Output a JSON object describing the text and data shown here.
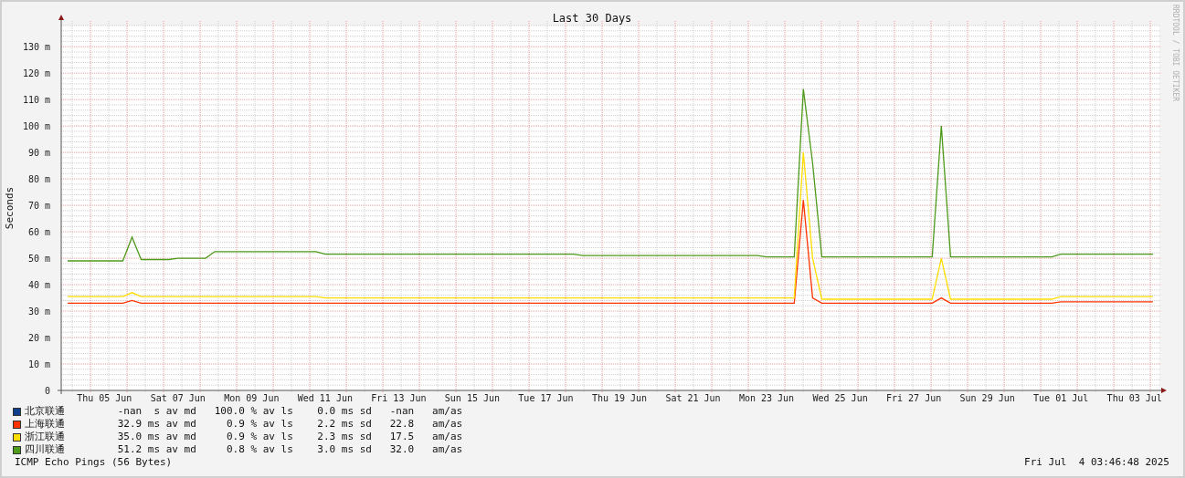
{
  "chart": {
    "chart_data": {
      "type": "line",
      "title": "Last 30 Days",
      "ylabel": "Seconds",
      "categories": [
        null,
        null,
        null,
        null,
        "Thu 05 Jun",
        null,
        null,
        null,
        null,
        null,
        null,
        null,
        "Sat 07 Jun",
        null,
        null,
        null,
        null,
        null,
        null,
        null,
        "Mon 09 Jun",
        null,
        null,
        null,
        null,
        null,
        null,
        null,
        "Wed 11 Jun",
        null,
        null,
        null,
        null,
        null,
        null,
        null,
        "Fri 13 Jun",
        null,
        null,
        null,
        null,
        null,
        null,
        null,
        "Sun 15 Jun",
        null,
        null,
        null,
        null,
        null,
        null,
        null,
        "Tue 17 Jun",
        null,
        null,
        null,
        null,
        null,
        null,
        null,
        "Thu 19 Jun",
        null,
        null,
        null,
        null,
        null,
        null,
        null,
        "Sat 21 Jun",
        null,
        null,
        null,
        null,
        null,
        null,
        null,
        "Mon 23 Jun",
        null,
        null,
        null,
        null,
        null,
        null,
        null,
        "Wed 25 Jun",
        null,
        null,
        null,
        null,
        null,
        null,
        null,
        "Fri 27 Jun",
        null,
        null,
        null,
        null,
        null,
        null,
        null,
        "Sun 29 Jun",
        null,
        null,
        null,
        null,
        null,
        null,
        null,
        "Tue 01 Jul",
        null,
        null,
        null,
        null,
        null,
        null,
        null,
        "Thu 03 Jul",
        null,
        null
      ],
      "series": [
        {
          "name": "上海联通",
          "color": "#ff3300",
          "values": [
            33,
            33,
            33,
            33,
            33,
            33,
            33,
            34,
            33,
            33,
            33,
            33,
            33,
            33,
            33,
            33,
            33,
            33,
            33,
            33,
            33,
            33,
            33,
            33,
            33,
            33,
            33,
            33,
            33,
            33,
            33,
            33,
            33,
            33,
            33,
            33,
            33,
            33,
            33,
            33,
            33,
            33,
            33,
            33,
            33,
            33,
            33,
            33,
            33,
            33,
            33,
            33,
            33,
            33,
            33,
            33,
            33,
            33,
            33,
            33,
            33,
            33,
            33,
            33,
            33,
            33,
            33,
            33,
            33,
            33,
            33,
            33,
            33,
            33,
            33,
            33,
            33,
            33,
            33,
            33,
            72,
            35,
            33,
            33,
            33,
            33,
            33,
            33,
            33,
            33,
            33,
            33,
            33,
            33,
            33,
            35,
            33,
            33,
            33,
            33,
            33,
            33,
            33,
            33,
            33,
            33,
            33,
            33,
            33.5,
            33.5,
            33.5,
            33.5,
            33.5,
            33.5,
            33.5,
            33.5,
            33.5,
            33.5,
            33.5
          ]
        },
        {
          "name": "浙江联通",
          "color": "#ffdd00",
          "values": [
            35.5,
            35.5,
            35.5,
            35.5,
            35.5,
            35.5,
            35.5,
            37,
            35.5,
            35.5,
            35.5,
            35.5,
            35.5,
            35.5,
            35.5,
            35.5,
            35.5,
            35.5,
            35.5,
            35.5,
            35.5,
            35.5,
            35.5,
            35.5,
            35.5,
            35.5,
            35.5,
            35.5,
            35,
            35,
            35,
            35,
            35,
            35,
            35,
            35,
            35,
            35,
            35,
            35,
            35,
            35,
            35,
            35,
            35,
            35,
            35,
            35,
            35,
            35,
            35,
            35,
            35,
            35,
            35,
            35,
            35,
            35,
            35,
            35,
            35,
            35,
            35,
            35,
            35,
            35,
            35,
            35,
            35,
            35,
            35,
            35,
            35,
            35,
            35,
            35,
            35,
            35,
            35,
            35,
            90,
            50,
            34.5,
            34.5,
            34.5,
            34.5,
            34.5,
            34.5,
            34.5,
            34.5,
            34.5,
            34.5,
            34.5,
            34.5,
            34.5,
            50,
            34.5,
            34.5,
            34.5,
            34.5,
            34.5,
            34.5,
            34.5,
            34.5,
            34.5,
            34.5,
            34.5,
            34.5,
            35.5,
            35.5,
            35.5,
            35.5,
            35.5,
            35.5,
            35.5,
            35.5,
            35.5,
            35.5,
            35.5
          ]
        },
        {
          "name": "四川联通",
          "color": "#4e9a1a",
          "values": [
            49,
            49,
            49,
            49,
            49,
            49,
            49,
            58,
            49.5,
            49.5,
            49.5,
            49.5,
            50,
            50,
            50,
            50,
            52.5,
            52.5,
            52.5,
            52.5,
            52.5,
            52.5,
            52.5,
            52.5,
            52.5,
            52.5,
            52.5,
            52.5,
            51.5,
            51.5,
            51.5,
            51.5,
            51.5,
            51.5,
            51.5,
            51.5,
            51.5,
            51.5,
            51.5,
            51.5,
            51.5,
            51.5,
            51.5,
            51.5,
            51.5,
            51.5,
            51.5,
            51.5,
            51.5,
            51.5,
            51.5,
            51.5,
            51.5,
            51.5,
            51.5,
            51.5,
            51,
            51,
            51,
            51,
            51,
            51,
            51,
            51,
            51,
            51,
            51,
            51,
            51,
            51,
            51,
            51,
            51,
            51,
            51,
            51,
            50.5,
            50.5,
            50.5,
            50.5,
            114,
            86,
            50.5,
            50.5,
            50.5,
            50.5,
            50.5,
            50.5,
            50.5,
            50.5,
            50.5,
            50.5,
            50.5,
            50.5,
            50.5,
            100,
            50.5,
            50.5,
            50.5,
            50.5,
            50.5,
            50.5,
            50.5,
            50.5,
            50.5,
            50.5,
            50.5,
            50.5,
            51.5,
            51.5,
            51.5,
            51.5,
            51.5,
            51.5,
            51.5,
            51.5,
            51.5,
            51.5,
            51.5
          ]
        }
      ],
      "ylim": [
        0,
        138
      ],
      "grid": true,
      "yticks": [
        {
          "value": 0,
          "label": "0"
        },
        {
          "value": 10,
          "label": "10 m"
        },
        {
          "value": 20,
          "label": "20 m"
        },
        {
          "value": 30,
          "label": "30 m"
        },
        {
          "value": 40,
          "label": "40 m"
        },
        {
          "value": 50,
          "label": "50 m"
        },
        {
          "value": 60,
          "label": "60 m"
        },
        {
          "value": 70,
          "label": "70 m"
        },
        {
          "value": 80,
          "label": "80 m"
        },
        {
          "value": 90,
          "label": "90 m"
        },
        {
          "value": 100,
          "label": "100 m"
        },
        {
          "value": 110,
          "label": "110 m"
        },
        {
          "value": 120,
          "label": "120 m"
        },
        {
          "value": 130,
          "label": "130 m"
        }
      ]
    },
    "credit": "RRDTOOL / TOBI OETIKER"
  },
  "legend": [
    {
      "name": "北京联通",
      "color": "#0f3f8c",
      "stats": "      -nan  s av md   100.0 % av ls    0.0 ms sd   -nan   am/as"
    },
    {
      "stats": "      32.9 ms av md     0.9 % av ls    2.2 ms sd   22.8   am/as"
    },
    {
      "stats": "      35.0 ms av md     0.9 % av ls    2.3 ms sd   17.5   am/as"
    },
    {
      "stats": "      51.2 ms av md     0.8 % av ls    3.0 ms sd   32.0   am/as"
    }
  ],
  "footer": {
    "probe": "ICMP Echo Pings (56 Bytes)",
    "timestamp": "Fri Jul  4 03:46:48 2025"
  }
}
